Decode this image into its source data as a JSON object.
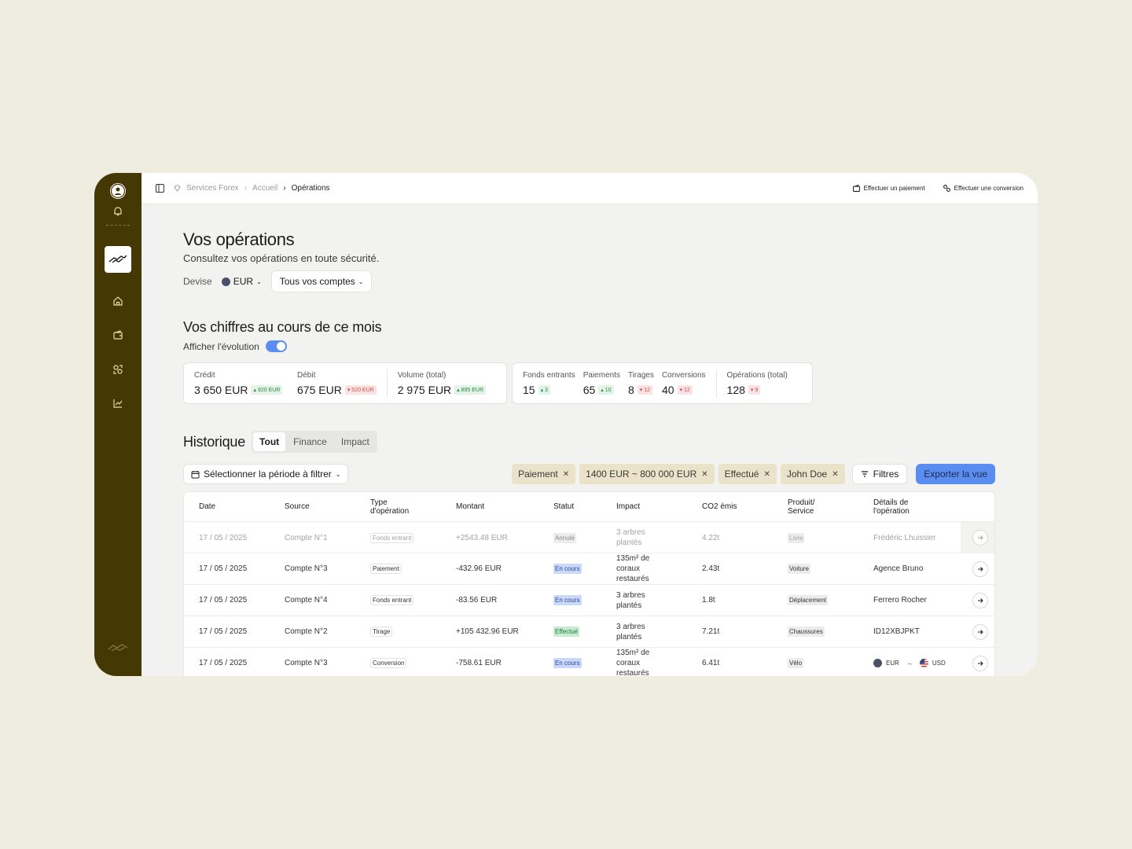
{
  "topbar": {
    "breadcrumb": [
      "Services Forex",
      "Accueil",
      "Opérations"
    ],
    "action_payment": "Effectuer un paiement",
    "action_conversion": "Effectuer une conversion"
  },
  "header": {
    "title": "Vos opérations",
    "subtitle": "Consultez vos opérations en toute sécurité.",
    "devise_label": "Devise",
    "currency": "EUR",
    "accounts_select": "Tous vos comptes"
  },
  "month": {
    "title": "Vos chiffres au cours de ce mois",
    "toggle_label": "Afficher l'évolution",
    "toggle_on": true,
    "finance": [
      {
        "label": "Crédit",
        "value": "3 650 EUR",
        "delta": "920 EUR",
        "dir": "up"
      },
      {
        "label": "Débit",
        "value": "675 EUR",
        "delta": "520 EUR",
        "dir": "down"
      },
      {
        "label": "Volume (total)",
        "value": "2 975 EUR",
        "delta": "895 EUR",
        "dir": "up"
      }
    ],
    "counts": [
      {
        "label": "Fonds entrants",
        "value": "15",
        "delta": "3",
        "dir": "up"
      },
      {
        "label": "Paiements",
        "value": "65",
        "delta": "10",
        "dir": "up"
      },
      {
        "label": "Tirages",
        "value": "8",
        "delta": "12",
        "dir": "down"
      },
      {
        "label": "Conversions",
        "value": "40",
        "delta": "12",
        "dir": "down"
      },
      {
        "label": "Opérations (total)",
        "value": "128",
        "delta": "9",
        "dir": "down"
      }
    ]
  },
  "history": {
    "title": "Historique",
    "tabs": [
      "Tout",
      "Finance",
      "Impact"
    ],
    "active_tab": "Tout",
    "period_button": "Sélectionner la période à filtrer",
    "filter_chips": [
      "Paiement",
      "1400 EUR ~ 800 000 EUR",
      "Effectué",
      "John Doe"
    ],
    "filters_button": "Filtres",
    "export_button": "Exporter la vue",
    "columns": [
      "Date",
      "Source",
      "Type d'opération",
      "Montant",
      "Statut",
      "Impact",
      "CO2 émis",
      "Produit/ Service",
      "Détails de l'opération"
    ],
    "rows": [
      {
        "date": "17 / 05 / 2025",
        "source": "Compte N°1",
        "type": "Fonds entrant",
        "montant": "+2543.48 EUR",
        "statut": "Annulé",
        "impact": "3 arbres plantés",
        "co2": "4.22t",
        "produit": "Livre",
        "details": "Frédéric Lhuissier"
      },
      {
        "date": "17 / 05 / 2025",
        "source": "Compte N°3",
        "type": "Paiement",
        "montant": "-432.96 EUR",
        "statut": "En cours",
        "impact": "135m² de coraux restaurés",
        "co2": "2.43t",
        "produit": "Voiture",
        "details": "Agence Bruno"
      },
      {
        "date": "17 / 05 / 2025",
        "source": "Compte N°4",
        "type": "Fonds entrant",
        "montant": "-83.56 EUR",
        "statut": "En cours",
        "impact": "3 arbres plantés",
        "co2": "1.8t",
        "produit": "Déplacement",
        "details": "Ferrero Rocher"
      },
      {
        "date": "17 / 05 / 2025",
        "source": "Compte N°2",
        "type": "Tirage",
        "montant": "+105 432.96 EUR",
        "statut": "Effectué",
        "impact": "3 arbres plantés",
        "co2": "7.21t",
        "produit": "Chaussures",
        "details": "ID12XBJPKT"
      },
      {
        "date": "17 / 05 / 2025",
        "source": "Compte N°3",
        "type": "Conversion",
        "montant": "-758.61 EUR",
        "statut": "En cours",
        "impact": "135m² de coraux restaurés",
        "co2": "6.41t",
        "produit": "Vélo",
        "details_from": "EUR",
        "details_to": "USD"
      }
    ]
  }
}
